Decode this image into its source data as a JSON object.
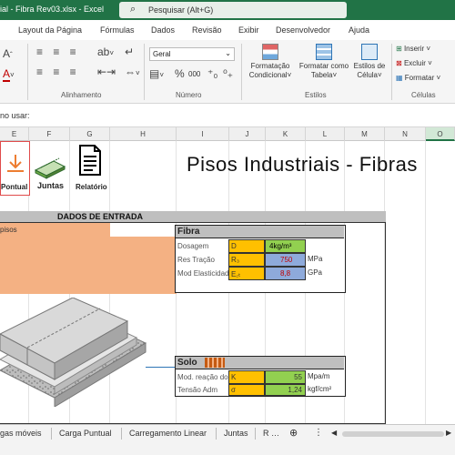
{
  "titlebar": {
    "title": "ial - Fibra Rev03.xlsx  -  Excel",
    "search_placeholder": "Pesquisar (Alt+G)"
  },
  "tabs": [
    "Layout da Página",
    "Fórmulas",
    "Dados",
    "Revisão",
    "Exibir",
    "Desenvolvedor",
    "Ajuda"
  ],
  "ribbon": {
    "number_format": "Geral",
    "group_alignment": "Alinhamento",
    "group_number": "Número",
    "group_styles": "Estilos",
    "group_cells": "Células",
    "cond_format": [
      "Formatação",
      "Condicional"
    ],
    "format_table": [
      "Formatar como",
      "Tabela"
    ],
    "cell_styles": [
      "Estilos de",
      "Célula"
    ],
    "insert": "Inserir",
    "delete": "Excluir",
    "format": "Formatar",
    "percent": "%",
    "thousands": "000"
  },
  "formula_bar": {
    "text": "no usar:"
  },
  "columns": [
    "E",
    "F",
    "G",
    "H",
    "I",
    "J",
    "K",
    "L",
    "M",
    "N",
    "O"
  ],
  "sheet": {
    "title": "Pisos Industriais - Fibras",
    "buttons": {
      "pontual": "Pontual",
      "juntas": "Juntas",
      "relatorio": "Relatório"
    },
    "dados_entrada": "DADOS DE ENTRADA",
    "pisos": "pisos",
    "fibra": {
      "title": "Fibra",
      "rows": [
        {
          "label": "Dosagem",
          "symbol": "D",
          "value": "4kg/m³",
          "unit": ""
        },
        {
          "label": "Res Tração",
          "symbol": "R₃",
          "value": "750",
          "unit": "MPa"
        },
        {
          "label": "Mod Elasticidade",
          "symbol": "E꜀ₜ",
          "value": "8,8",
          "unit": "GPa"
        }
      ]
    },
    "solo": {
      "title": "Solo",
      "rows": [
        {
          "label": "Mod. reação do",
          "symbol": "K",
          "value": "55",
          "unit": "Mpa/m"
        },
        {
          "label": "Tensão Adm",
          "symbol": "σ",
          "value": "1,24",
          "unit": "kgf/cm²"
        }
      ]
    }
  },
  "sheet_tabs": [
    "gas móveis",
    "Carga Puntual",
    "Carregamento Linear",
    "Juntas",
    "R"
  ],
  "colors": {
    "excel_green": "#217346",
    "salmon": "#f4b183",
    "orange": "#ffc000",
    "green": "#92d050",
    "blue": "#8eaadb",
    "header_gray": "#bfbfbf"
  }
}
